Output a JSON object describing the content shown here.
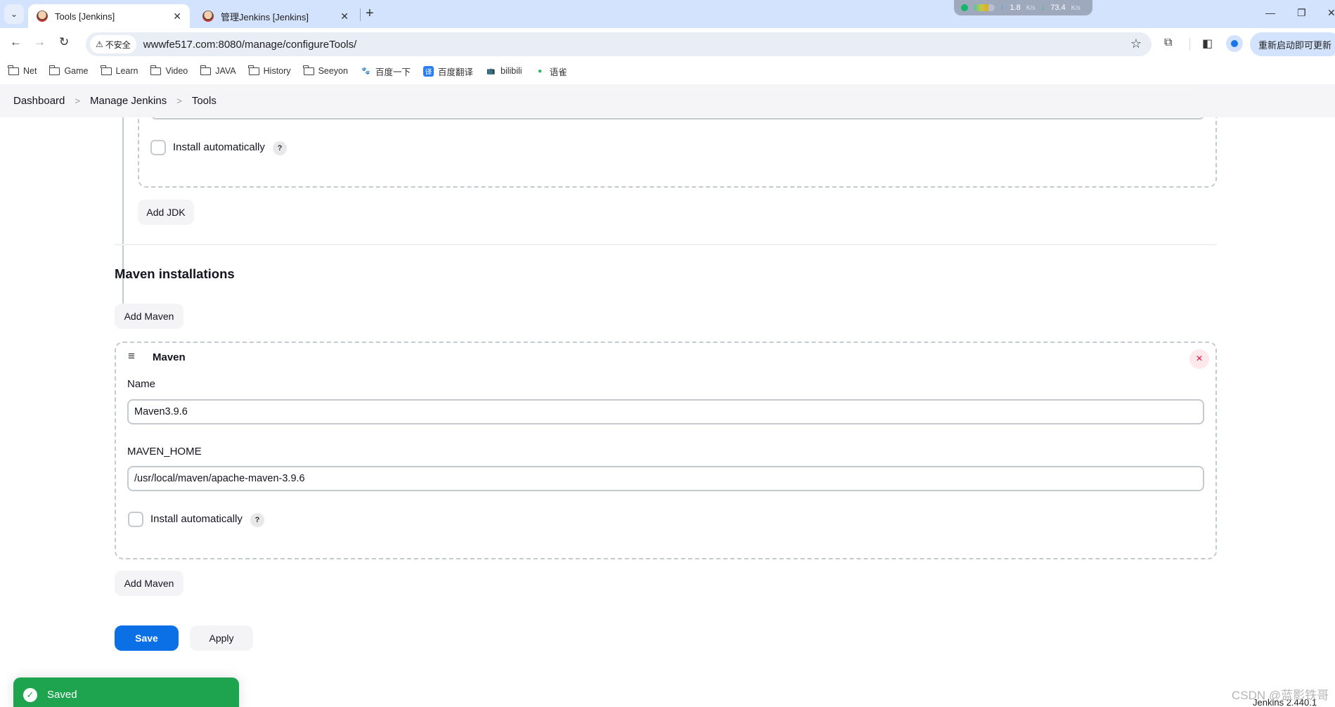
{
  "browser": {
    "tabs": [
      {
        "title": "Tools [Jenkins]",
        "active": true
      },
      {
        "title": "管理Jenkins [Jenkins]",
        "active": false
      }
    ],
    "new_tab_label": "+",
    "net_monitor": {
      "upload": "1.8",
      "upload_unit": "K/s",
      "download": "73.4",
      "download_unit": "K/s"
    },
    "security_label": "不安全",
    "url": "wwwfe517.com:8080/manage/configureTools/",
    "update_button": "重新启动即可更新",
    "bookmarks": [
      {
        "label": "Net",
        "icon": "folder-icon"
      },
      {
        "label": "Game",
        "icon": "folder-icon"
      },
      {
        "label": "Learn",
        "icon": "folder-icon"
      },
      {
        "label": "Video",
        "icon": "folder-icon"
      },
      {
        "label": "JAVA",
        "icon": "folder-icon"
      },
      {
        "label": "History",
        "icon": "folder-icon"
      },
      {
        "label": "Seeyon",
        "icon": "folder-icon"
      },
      {
        "label": "百度一下",
        "icon": "baidu-paw-icon"
      },
      {
        "label": "百度翻译",
        "icon": "translate-icon"
      },
      {
        "label": "bilibili",
        "icon": "bilibili-tv-icon"
      },
      {
        "label": "语雀",
        "icon": "yuque-bird-icon"
      }
    ]
  },
  "breadcrumb": [
    "Dashboard",
    "Manage Jenkins",
    "Tools"
  ],
  "jdk": {
    "install_auto_label": "Install automatically",
    "install_auto_checked": false,
    "help": "?",
    "add_button": "Add JDK"
  },
  "maven": {
    "heading": "Maven installations",
    "add_button_top": "Add Maven",
    "installation": {
      "title": "Maven",
      "name_label": "Name",
      "name_value": "Maven3.9.6",
      "home_label": "MAVEN_HOME",
      "home_value": "/usr/local/maven/apache-maven-3.9.6",
      "install_auto_label": "Install automatically",
      "install_auto_checked": false,
      "help": "?",
      "close_symbol": "×"
    },
    "add_button_bottom": "Add Maven"
  },
  "actions": {
    "save": "Save",
    "apply": "Apply"
  },
  "toast": {
    "message": "Saved"
  },
  "footer": {
    "version": "Jenkins 2.440.1",
    "watermark": "CSDN @蓝影铁哥"
  },
  "colors": {
    "primary": "#0b6fe5",
    "success": "#1ea44f",
    "danger": "#e6003f"
  }
}
